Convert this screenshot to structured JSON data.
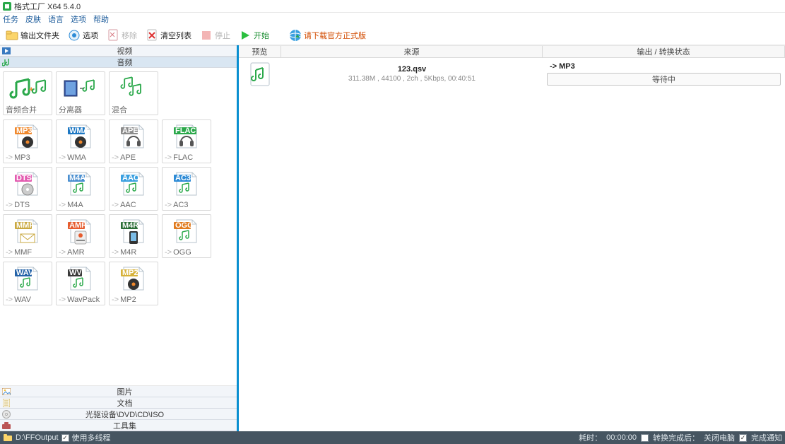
{
  "window": {
    "title": "格式工厂 X64 5.4.0"
  },
  "menu": [
    "任务",
    "皮肤",
    "语言",
    "选项",
    "帮助"
  ],
  "toolbar": {
    "outdir": "输出文件夹",
    "options": "选项",
    "remove": "移除",
    "clear": "清空列表",
    "stop": "停止",
    "start": "开始",
    "official": "请下载官方正式版"
  },
  "sidebar": {
    "cats_top": [
      "视频",
      "音频"
    ],
    "row_util": [
      {
        "label": "音频合并"
      },
      {
        "label": "分离器"
      },
      {
        "label": "混合"
      }
    ],
    "row_formats": [
      {
        "tag": "MP3",
        "tagColor": "#f0882c",
        "label": "MP3"
      },
      {
        "tag": "WMA",
        "tagColor": "#1c77c3",
        "label": "WMA"
      },
      {
        "tag": "APE",
        "tagColor": "#8b8b8b",
        "label": "APE"
      },
      {
        "tag": "FLAC",
        "tagColor": "#2aa84a",
        "label": "FLAC"
      },
      {
        "tag": "DTS",
        "tagColor": "#e35bb0",
        "label": "DTS"
      },
      {
        "tag": "M4A",
        "tagColor": "#4a8fd0",
        "label": "M4A"
      },
      {
        "tag": "AAC",
        "tagColor": "#3aa0e0",
        "label": "AAC"
      },
      {
        "tag": "AC3",
        "tagColor": "#2d8bd6",
        "label": "AC3"
      },
      {
        "tag": "MMF",
        "tagColor": "#c9a840",
        "label": "MMF"
      },
      {
        "tag": "AMR",
        "tagColor": "#e65c2e",
        "label": "AMR"
      },
      {
        "tag": "M4R",
        "tagColor": "#2a6d36",
        "label": "M4R"
      },
      {
        "tag": "OGG",
        "tagColor": "#e07a1e",
        "label": "OGG"
      },
      {
        "tag": "WAV",
        "tagColor": "#2563a8",
        "label": "WAV"
      },
      {
        "tag": "WV",
        "tagColor": "#3a3a3a",
        "label": "WavPack"
      },
      {
        "tag": "MP2",
        "tagColor": "#d6b23a",
        "label": "MP2"
      }
    ],
    "cats_bottom": [
      "图片",
      "文档",
      "光驱设备\\DVD\\CD\\ISO",
      "工具集"
    ]
  },
  "right": {
    "headers": {
      "preview": "预览",
      "source": "来源",
      "status": "输出 / 转换状态"
    },
    "task": {
      "filename": "123.qsv",
      "info": "311.38M , 44100 , 2ch , 5Kbps, 00:40:51",
      "target": "-> MP3",
      "progress_label": "等待中"
    }
  },
  "status": {
    "outdir_label": "D:\\FFOutput",
    "multithread": "使用多线程",
    "elapsed_label": "耗时：",
    "elapsed_value": "00:00:00",
    "after_done": "转换完成后：",
    "shutdown": "关闭电脑",
    "notify": "完成通知"
  }
}
